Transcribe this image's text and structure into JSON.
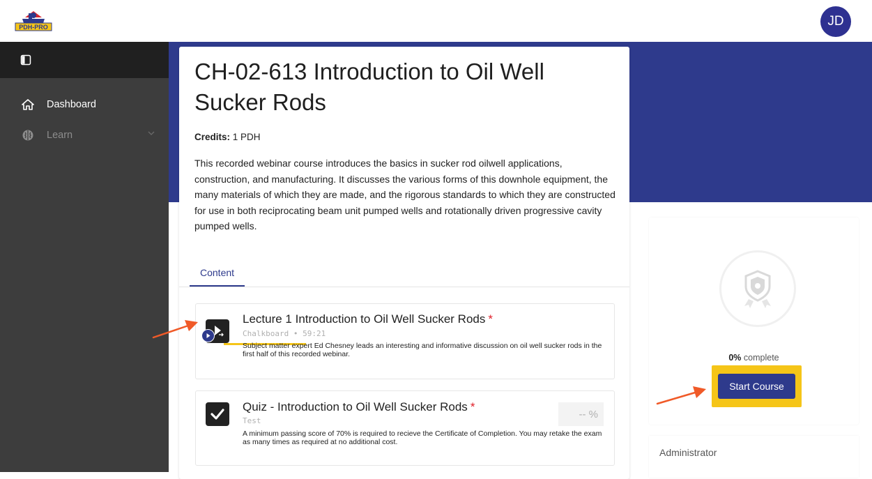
{
  "header": {
    "logo_text": "PDH-PRO",
    "avatar_initials": "JD"
  },
  "sidebar": {
    "items": [
      {
        "label": "Dashboard",
        "icon": "home-icon",
        "active": true
      },
      {
        "label": "Learn",
        "icon": "brain-icon",
        "active": false
      }
    ]
  },
  "course": {
    "title": "CH-02-613 Introduction to Oil Well Sucker Rods",
    "credits_label": "Credits:",
    "credits_value": " 1 PDH",
    "description": "This recorded webinar course introduces the basics in sucker rod oilwell applications, construction, and manufacturing. It discusses the various forms of this downhole equipment, the many materials of which they are made, and the rigorous standards to which they are constructed for use in both reciprocating beam unit pumped wells and rotationally driven progressive cavity pumped wells.",
    "tabs": [
      {
        "label": "Content"
      }
    ]
  },
  "content_items": [
    {
      "title": "Lecture 1 Introduction to Oil Well Sucker Rods",
      "required_mark": "*",
      "subtitle": "Chalkboard • 59:21",
      "description": "Subject matter expert Ed Chesney leads an interesting and informative discussion on oil well sucker rods in the first half of this recorded webinar.",
      "icon": "video-icon"
    },
    {
      "title": "Quiz - Introduction to Oil Well Sucker Rods",
      "required_mark": "*",
      "subtitle": "Test",
      "description": "A minimum passing score of 70% is required to recieve the Certificate of Completion. You may retake the exam as many times as required at no additional cost.",
      "score": "-- %",
      "icon": "checkmark-icon"
    }
  ],
  "progress": {
    "percent": "0%",
    "complete_label": " complete",
    "start_button": "Start Course"
  },
  "admin": {
    "label": "Administrator"
  },
  "colors": {
    "brand": "#2e3a8c",
    "highlight": "#f5c518",
    "arrow": "#f05a28",
    "required": "#e0202a",
    "sidebar": "#3d3d3d"
  }
}
